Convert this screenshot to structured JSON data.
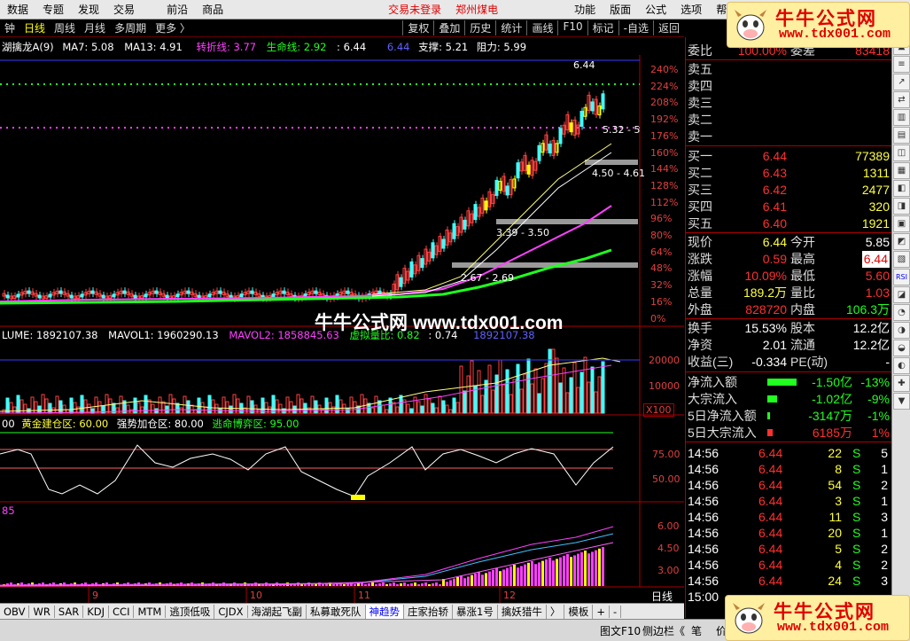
{
  "menu": {
    "items": [
      "数据",
      "专题",
      "发现",
      "交易",
      "前沿",
      "商品"
    ],
    "trade_status": "交易未登录",
    "exchange": "郑州煤电",
    "right_items": [
      "功能",
      "版面",
      "公式",
      "选项",
      "帮"
    ]
  },
  "toolbar": {
    "period_items": [
      "钟",
      "日线",
      "周线",
      "月线",
      "多周期",
      "更多 〉"
    ],
    "right_buttons": [
      "复权",
      "叠加",
      "历史",
      "统计",
      "画线",
      "F10",
      "标记",
      "-自选",
      "返回"
    ]
  },
  "main_legend": {
    "name": "湖擒龙A(9)",
    "ma7": "MA7: 5.08",
    "ma13": "MA13: 4.91",
    "turn": "转折线: 3.77",
    "life": "生命线: 2.92",
    "v1": ": 6.44",
    "v2": "6.44",
    "support": "支撑: 5.21",
    "resist": "阻力: 5.99"
  },
  "price_axis": [
    "240%",
    "224%",
    "208%",
    "192%",
    "176%",
    "160%",
    "144%",
    "128%",
    "112%",
    "96%",
    "80%",
    "64%",
    "48%",
    "32%",
    "16%",
    "0%"
  ],
  "chart_notes": {
    "high": "6.44",
    "band1": "3.39 - 3.50",
    "band2": "2.67 - 2.69",
    "band3": "4.50 - 4.61",
    "band4": "5.32 - 5"
  },
  "vol_legend": {
    "volume": "LUME: 1892107.38",
    "mavol1": "MAVOL1: 1960290.13",
    "mavol2": "MAVOL2: 1858845.63",
    "xlb": "虚拟量比: 0.82",
    "ratio": ": 0.74",
    "v": "1892107.38"
  },
  "vol_axis": [
    "20000",
    "10000"
  ],
  "vol_unit": "X100",
  "osc_legend": {
    "v": "00",
    "zone1": "黄金建仓区: 60.00",
    "zone2": "强势加仓区: 80.00",
    "zone3": "逃命博弈区: 95.00"
  },
  "osc_axis": [
    "75.00",
    "50.00"
  ],
  "sub_legend": "85",
  "sub_axis": [
    "6.00",
    "4.50",
    "3.00"
  ],
  "x_axis": [
    "9",
    "10",
    "11",
    "12"
  ],
  "x_period": "日线",
  "bottom_tabs": [
    "OBV",
    "WR",
    "SAR",
    "KDJ",
    "CCI",
    "MTM",
    "逃顶低吸",
    "CJDX",
    "海湖起飞副",
    "私募敢死队",
    "神趋势",
    "庄家抬轿",
    "暴涨1号",
    "擒妖猎牛",
    "〉",
    "模板",
    "+",
    "-"
  ],
  "quote": {
    "weibi_label": "委比",
    "weibi": "100.00%",
    "weicha_label": "委差",
    "weicha": "83418",
    "sells": [
      {
        "label": "卖五",
        "price": "",
        "vol": ""
      },
      {
        "label": "卖四",
        "price": "",
        "vol": ""
      },
      {
        "label": "卖三",
        "price": "",
        "vol": ""
      },
      {
        "label": "卖二",
        "price": "",
        "vol": ""
      },
      {
        "label": "卖一",
        "price": "",
        "vol": ""
      }
    ],
    "buys": [
      {
        "label": "买一",
        "price": "6.44",
        "vol": "77389"
      },
      {
        "label": "买二",
        "price": "6.43",
        "vol": "1311"
      },
      {
        "label": "买三",
        "price": "6.42",
        "vol": "2477"
      },
      {
        "label": "买四",
        "price": "6.41",
        "vol": "320"
      },
      {
        "label": "买五",
        "price": "6.40",
        "vol": "1921"
      }
    ],
    "stats": [
      {
        "l1": "现价",
        "v1": "6.44",
        "l2": "今开",
        "v2": "5.85"
      },
      {
        "l1": "涨跌",
        "v1": "0.59",
        "l2": "最高",
        "v2": "6.44"
      },
      {
        "l1": "涨幅",
        "v1": "10.09%",
        "l2": "最低",
        "v2": "5.60"
      },
      {
        "l1": "总量",
        "v1": "189.2万",
        "l2": "量比",
        "v2": "1.03"
      },
      {
        "l1": "外盘",
        "v1": "828720",
        "l2": "内盘",
        "v2": "106.3万"
      }
    ],
    "stats2": [
      {
        "l1": "换手",
        "v1": "15.53%",
        "l2": "股本",
        "v2": "12.2亿"
      },
      {
        "l1": "净资",
        "v1": "2.01",
        "l2": "流通",
        "v2": "12.2亿"
      },
      {
        "l1": "收益(三)",
        "v1": "-0.334",
        "l2": "PE(动)",
        "v2": "-"
      }
    ],
    "flows": [
      {
        "label": "净流入额",
        "value": "-1.50亿",
        "pct": "-13%",
        "bar": 60
      },
      {
        "label": "大宗流入",
        "value": "-1.02亿",
        "pct": "-9%",
        "bar": 20
      },
      {
        "label": "5日净流入额",
        "value": "-3147万",
        "pct": "-1%",
        "bar": 5
      },
      {
        "label": "5日大宗流入",
        "value": "6185万",
        "pct": "1%",
        "bar": 10
      }
    ],
    "ticks": [
      {
        "t": "14:56",
        "p": "6.44",
        "v": "22",
        "s": "S",
        "n": "5"
      },
      {
        "t": "14:56",
        "p": "6.44",
        "v": "8",
        "s": "S",
        "n": "1"
      },
      {
        "t": "14:56",
        "p": "6.44",
        "v": "54",
        "s": "S",
        "n": "2"
      },
      {
        "t": "14:56",
        "p": "6.44",
        "v": "3",
        "s": "S",
        "n": "1"
      },
      {
        "t": "14:56",
        "p": "6.44",
        "v": "11",
        "s": "S",
        "n": "3"
      },
      {
        "t": "14:56",
        "p": "6.44",
        "v": "20",
        "s": "S",
        "n": "1"
      },
      {
        "t": "14:56",
        "p": "6.44",
        "v": "5",
        "s": "S",
        "n": "2"
      },
      {
        "t": "14:56",
        "p": "6.44",
        "v": "4",
        "s": "S",
        "n": "2"
      },
      {
        "t": "14:56",
        "p": "6.44",
        "v": "24",
        "s": "S",
        "n": "3"
      },
      {
        "t": "15:00",
        "p": "",
        "v": "",
        "s": "",
        "n": ""
      }
    ]
  },
  "status": {
    "left": "图文F10",
    "mid": "侧边栏《",
    "tab": "笔",
    "tab2": "价"
  },
  "watermark": {
    "cn": "牛牛公式网",
    "url": "www.tdx001.com"
  },
  "center_watermark": "牛牛公式网 www.tdx001.com"
}
